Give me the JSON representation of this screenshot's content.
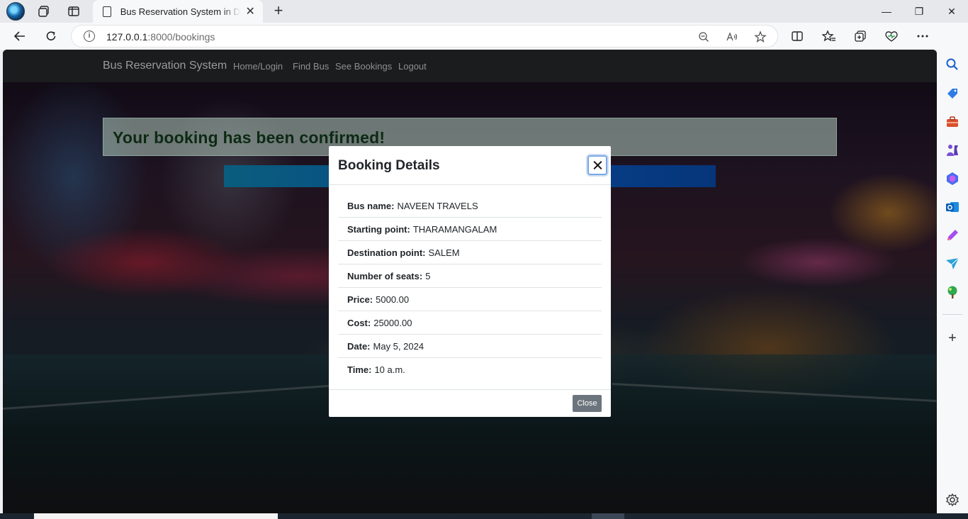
{
  "browser": {
    "tab_title": "Bus Reservation System in Django",
    "url_host": "127.0.0.1",
    "url_rest": ":8000/bookings",
    "new_tab_symbol": "+",
    "tab_close_symbol": "✕",
    "window_controls": {
      "minimize": "—",
      "restore": "❐",
      "close": "✕"
    },
    "toolbar_icons": [
      "back-icon",
      "refresh-icon",
      "info-icon",
      "zoom-out-icon",
      "read-aloud-icon",
      "favorite-star-icon",
      "split-screen-icon",
      "favorites-icon",
      "collections-icon",
      "browser-essentials-icon",
      "more-icon",
      "copilot-icon"
    ],
    "sidebar_icons": [
      "search-icon",
      "shopping-icon",
      "tools-icon",
      "games-icon",
      "microsoft365-icon",
      "outlook-icon",
      "designer-icon",
      "drop-icon",
      "tree-icon",
      "add-icon",
      "settings-icon"
    ]
  },
  "navbar": {
    "brand": "Bus Reservation System",
    "links": [
      "Home/Login",
      "Find Bus",
      "See Bookings",
      "Logout"
    ]
  },
  "alert": {
    "message": "Your booking has been confirmed!"
  },
  "modal": {
    "title": "Booking Details",
    "rows": [
      {
        "label": "Bus name:",
        "value": "NAVEEN TRAVELS"
      },
      {
        "label": "Starting point:",
        "value": "THARAMANGALAM"
      },
      {
        "label": "Destination point:",
        "value": "SALEM"
      },
      {
        "label": "Number of seats:",
        "value": "5"
      },
      {
        "label": "Price:",
        "value": "5000.00"
      },
      {
        "label": "Cost:",
        "value": "25000.00"
      },
      {
        "label": "Date:",
        "value": "May 5, 2024"
      },
      {
        "label": "Time:",
        "value": "10 a.m."
      }
    ],
    "close_label": "Close"
  },
  "colors": {
    "navbar_bg": "#1b1c1e",
    "primary_button": "#06357a",
    "secondary_button": "#6c757d",
    "alert_text": "#0d2a14"
  }
}
